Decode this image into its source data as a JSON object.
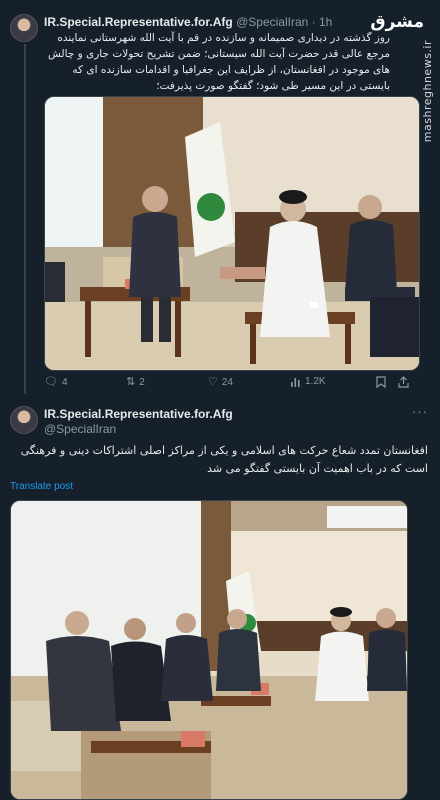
{
  "tweet1": {
    "author_name": "IR.Special.Representative.for.Afg",
    "handle": "@SpecialIran",
    "dot": "·",
    "time": "1h",
    "more_label": "···",
    "text": "روز گذشته در دیداری صمیمانه و سازنده در قم با آیت الله شهرستانی نماینده مرجع عالی قدر حضرت آیت الله سیستانی؛ ضمن تشریح تحولات جاری و چالش های موجود در افغانستان، از ظرایف این جغرافیا و اقدامات سازنده ای که بایستی در این مسیر طی شود؛ گفتگو صورت پذیرفت؛",
    "actions": {
      "replies": "4",
      "reposts": "2",
      "likes": "24",
      "views": "1.2K"
    }
  },
  "tweet2": {
    "author_name": "IR.Special.Representative.for.Afg",
    "handle": "@SpecialIran",
    "more_label": "···",
    "text": "افغانستان تمدد شعاع حرکت های اسلامی و یکی از مراکز اصلی اشتراکات دینی و فرهنگی است که در باب اهمیت آن بایستی گفتگو می شد",
    "translate_label": "Translate post"
  },
  "watermark": {
    "logo": "مشرق",
    "site": "mashreghnews.ir"
  },
  "colors": {
    "background": "#15202b",
    "link": "#1d9bf0",
    "muted": "#8b98a5"
  }
}
